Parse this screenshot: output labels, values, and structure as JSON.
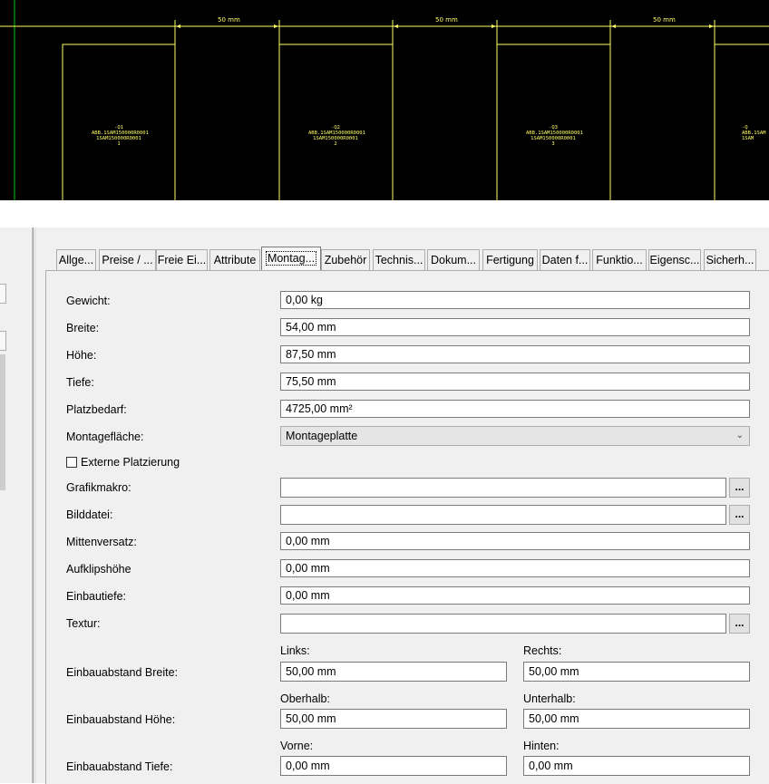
{
  "cad": {
    "dimension_label": "50 mm",
    "devices": [
      {
        "tag": "-Q1",
        "part": "ABB.1SAM150000R0001",
        "type": "1SAM150000R0001",
        "num": "1"
      },
      {
        "tag": "-Q2",
        "part": "ABB.1SAM150000R0001",
        "type": "1SAM150000R0001",
        "num": "2"
      },
      {
        "tag": "-Q3",
        "part": "ABB.1SAM150000R0001",
        "type": "1SAM150000R0001",
        "num": "3"
      },
      {
        "tag": "-Q",
        "part": "ABB.1SAM",
        "type": "1SAM",
        "num": ""
      }
    ]
  },
  "tabs": [
    "Allge...",
    "Preise / ...",
    "Freie Ei...",
    "Attribute",
    "Montag...",
    "Zubehör",
    "Technis...",
    "Dokum...",
    "Fertigung",
    "Daten f...",
    "Funktio...",
    "Eigensc...",
    "Sicherh..."
  ],
  "active_tab": "Montag...",
  "form": {
    "gewicht": {
      "label": "Gewicht:",
      "value": "0,00 kg"
    },
    "breite": {
      "label": "Breite:",
      "value": "54,00 mm"
    },
    "hoehe": {
      "label": "Höhe:",
      "value": "87,50 mm"
    },
    "tiefe": {
      "label": "Tiefe:",
      "value": "75,50 mm"
    },
    "platzbedarf": {
      "label": "Platzbedarf:",
      "value": "4725,00 mm²"
    },
    "montageflaeche": {
      "label": "Montagefläche:",
      "value": "Montageplatte"
    },
    "externe": {
      "label": "Externe Platzierung",
      "checked": false
    },
    "grafikmakro": {
      "label": "Grafikmakro:",
      "value": ""
    },
    "bilddatei": {
      "label": "Bilddatei:",
      "value": ""
    },
    "mittenversatz": {
      "label": "Mittenversatz:",
      "value": "0,00 mm"
    },
    "aufklipshoehe": {
      "label": "Aufklipshöhe",
      "value": "0,00 mm"
    },
    "einbautiefe": {
      "label": "Einbautiefe:",
      "value": "0,00 mm"
    },
    "textur": {
      "label": "Textur:",
      "value": ""
    },
    "browse_label": "...",
    "abstand_breite": {
      "label": "Einbauabstand Breite:",
      "left_label": "Links:",
      "left_value": "50,00 mm",
      "right_label": "Rechts:",
      "right_value": "50,00 mm"
    },
    "abstand_hoehe": {
      "label": "Einbauabstand Höhe:",
      "left_label": "Oberhalb:",
      "left_value": "50,00 mm",
      "right_label": "Unterhalb:",
      "right_value": "50,00 mm"
    },
    "abstand_tiefe": {
      "label": "Einbauabstand Tiefe:",
      "left_label": "Vorne:",
      "left_value": "0,00 mm",
      "right_label": "Hinten:",
      "right_value": "0,00 mm"
    }
  }
}
